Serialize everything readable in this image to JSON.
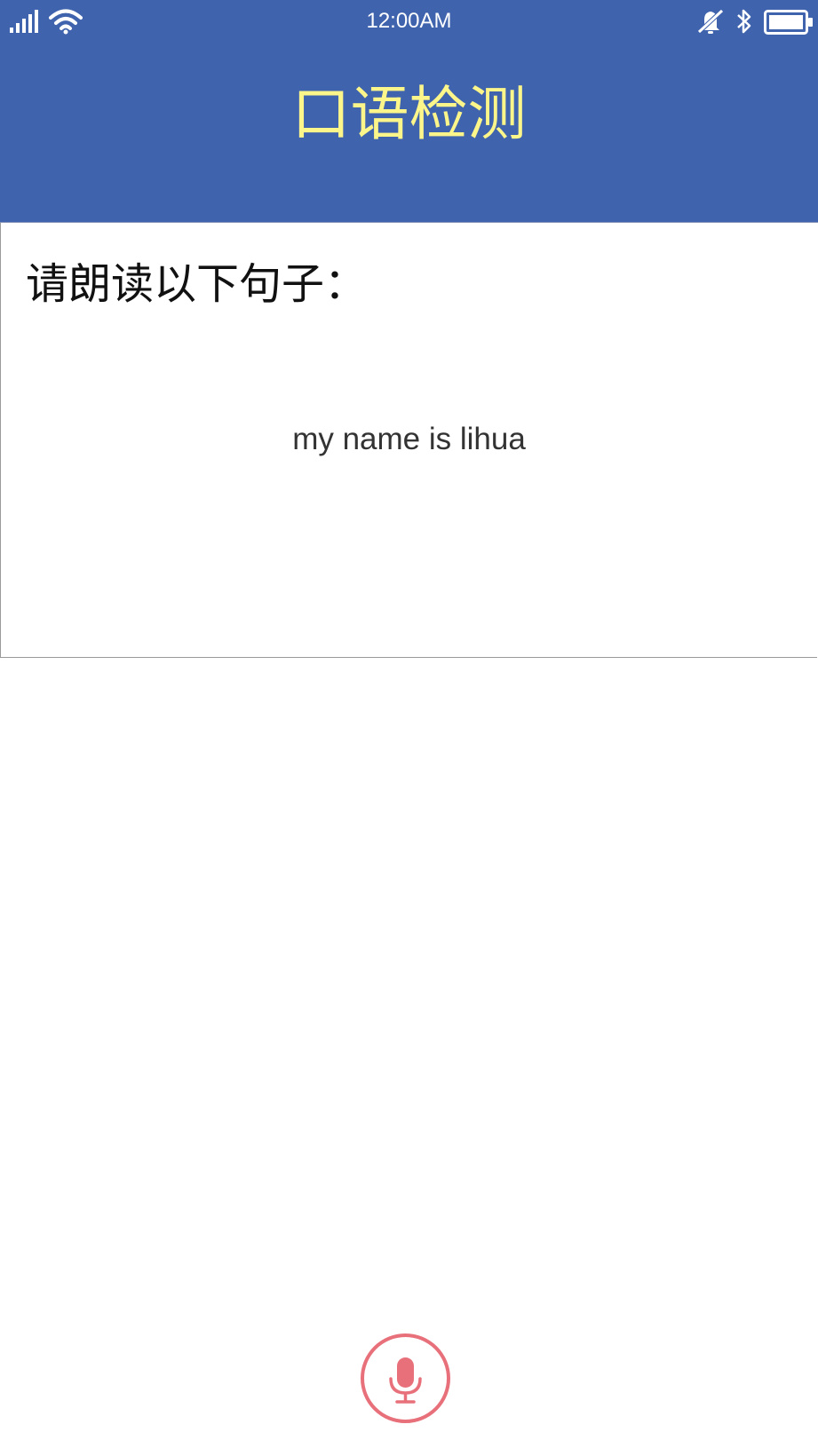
{
  "status_bar": {
    "time": "12:00AM",
    "icons": [
      "signal-icon",
      "wifi-icon",
      "mute-icon",
      "bluetooth-icon",
      "battery-icon"
    ]
  },
  "header": {
    "title": "口语检测",
    "background_color": "#4063ae",
    "title_color": "#fbf58a"
  },
  "prompt": {
    "label": "请朗读以下句子：",
    "sentence": "my name is lihua"
  },
  "record": {
    "icon": "microphone-icon",
    "accent_color": "#e8707a"
  }
}
